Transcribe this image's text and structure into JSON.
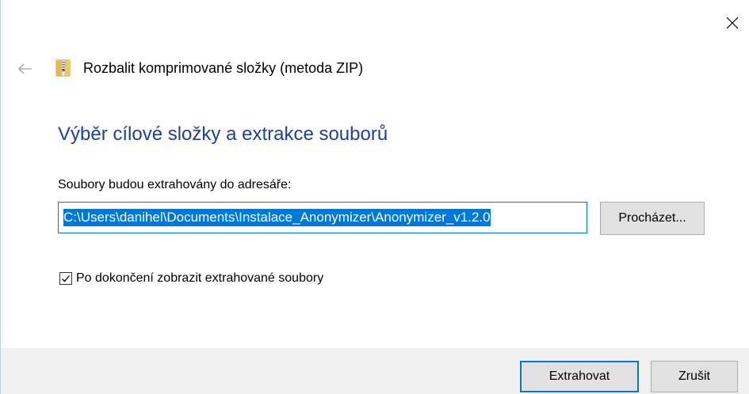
{
  "window": {
    "header_title": "Rozbalit komprimované složky (metoda ZIP)",
    "icons": {
      "close": "close-icon",
      "back": "back-arrow-icon",
      "zip": "zip-folder-icon"
    }
  },
  "main": {
    "heading": "Výběr cílové složky a extrakce souborů",
    "path_label": "Soubory budou extrahovány do adresáře:",
    "path_value": "C:\\Users\\danihel\\Documents\\Instalace_Anonymizer\\Anonymizer_v1.2.0",
    "browse_label": "Procházet...",
    "checkbox_label": "Po dokončení zobrazit extrahované soubory",
    "checkbox_checked": true
  },
  "footer": {
    "extract_label": "Extrahovat",
    "cancel_label": "Zrušit"
  },
  "colors": {
    "heading": "#1e3f9c",
    "accent": "#0078d7",
    "footer_bg": "#f0f0f0",
    "button_bg": "#e1e1e1"
  }
}
